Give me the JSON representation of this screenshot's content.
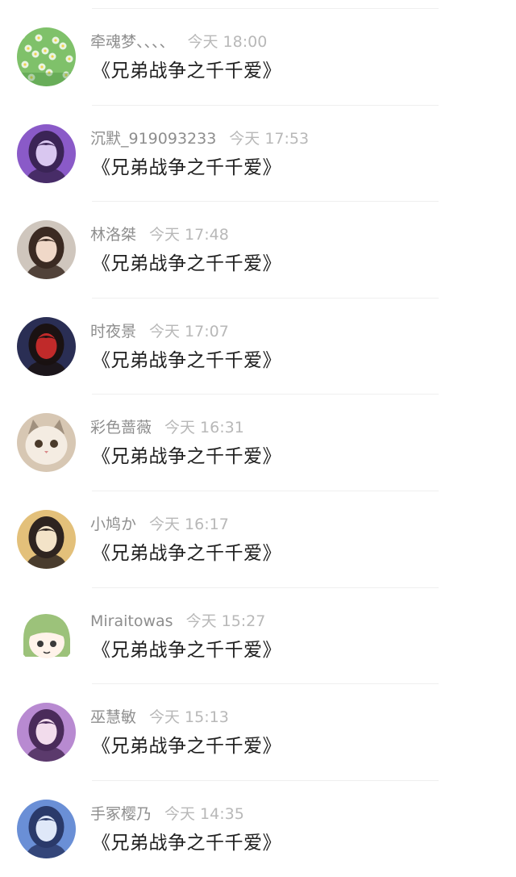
{
  "comments": [
    {
      "user": "牵魂梦、、、、",
      "time": "今天 18:00",
      "text": "《兄弟战争之千千爱》",
      "avatar": "flowers-avatar-icon",
      "colors": [
        "#7fc16a",
        "#e9f4e2",
        "#3f8a38"
      ]
    },
    {
      "user": "沉默_919093233",
      "time": "今天 17:53",
      "text": "《兄弟战争之千千爱》",
      "avatar": "anime-girl-purple-avatar-icon",
      "colors": [
        "#8a5ac8",
        "#d9c7f0",
        "#3b2456"
      ]
    },
    {
      "user": "林洛桀",
      "time": "今天 17:48",
      "text": "《兄弟战争之千千爱》",
      "avatar": "girl-portrait-avatar-icon",
      "colors": [
        "#cfc6bd",
        "#f0d8c8",
        "#3b2a22"
      ]
    },
    {
      "user": "时夜景",
      "time": "今天 17:07",
      "text": "《兄弟战争之千千爱》",
      "avatar": "red-dress-avatar-icon",
      "colors": [
        "#2a2e54",
        "#c02a2a",
        "#1a1212"
      ]
    },
    {
      "user": "彩色蔷薇",
      "time": "今天 16:31",
      "text": "《兄弟战争之千千爱》",
      "avatar": "cat-avatar-icon",
      "colors": [
        "#d7c7b3",
        "#f4ece2",
        "#7b6a5a"
      ]
    },
    {
      "user": "小鸠か",
      "time": "今天 16:17",
      "text": "《兄弟战争之千千爱》",
      "avatar": "girl-with-cat-avatar-icon",
      "colors": [
        "#e3c07a",
        "#f3e3c8",
        "#2e2420"
      ]
    },
    {
      "user": "Miraitowas",
      "time": "今天 15:27",
      "text": "《兄弟战争之千千爱》",
      "avatar": "green-hair-chibi-avatar-icon",
      "colors": [
        "#ffffff",
        "#9cc27a",
        "#3a3a3a"
      ]
    },
    {
      "user": "巫慧敏",
      "time": "今天 15:13",
      "text": "《兄弟战争之千千爱》",
      "avatar": "anime-princess-avatar-icon",
      "colors": [
        "#b88ad1",
        "#f2dcec",
        "#4a2b5a"
      ]
    },
    {
      "user": "手冢樱乃",
      "time": "今天 14:35",
      "text": "《兄弟战争之千千爱》",
      "avatar": "blue-fairy-avatar-icon",
      "colors": [
        "#6a8fd6",
        "#dfe8f8",
        "#2a3a6a"
      ]
    }
  ]
}
